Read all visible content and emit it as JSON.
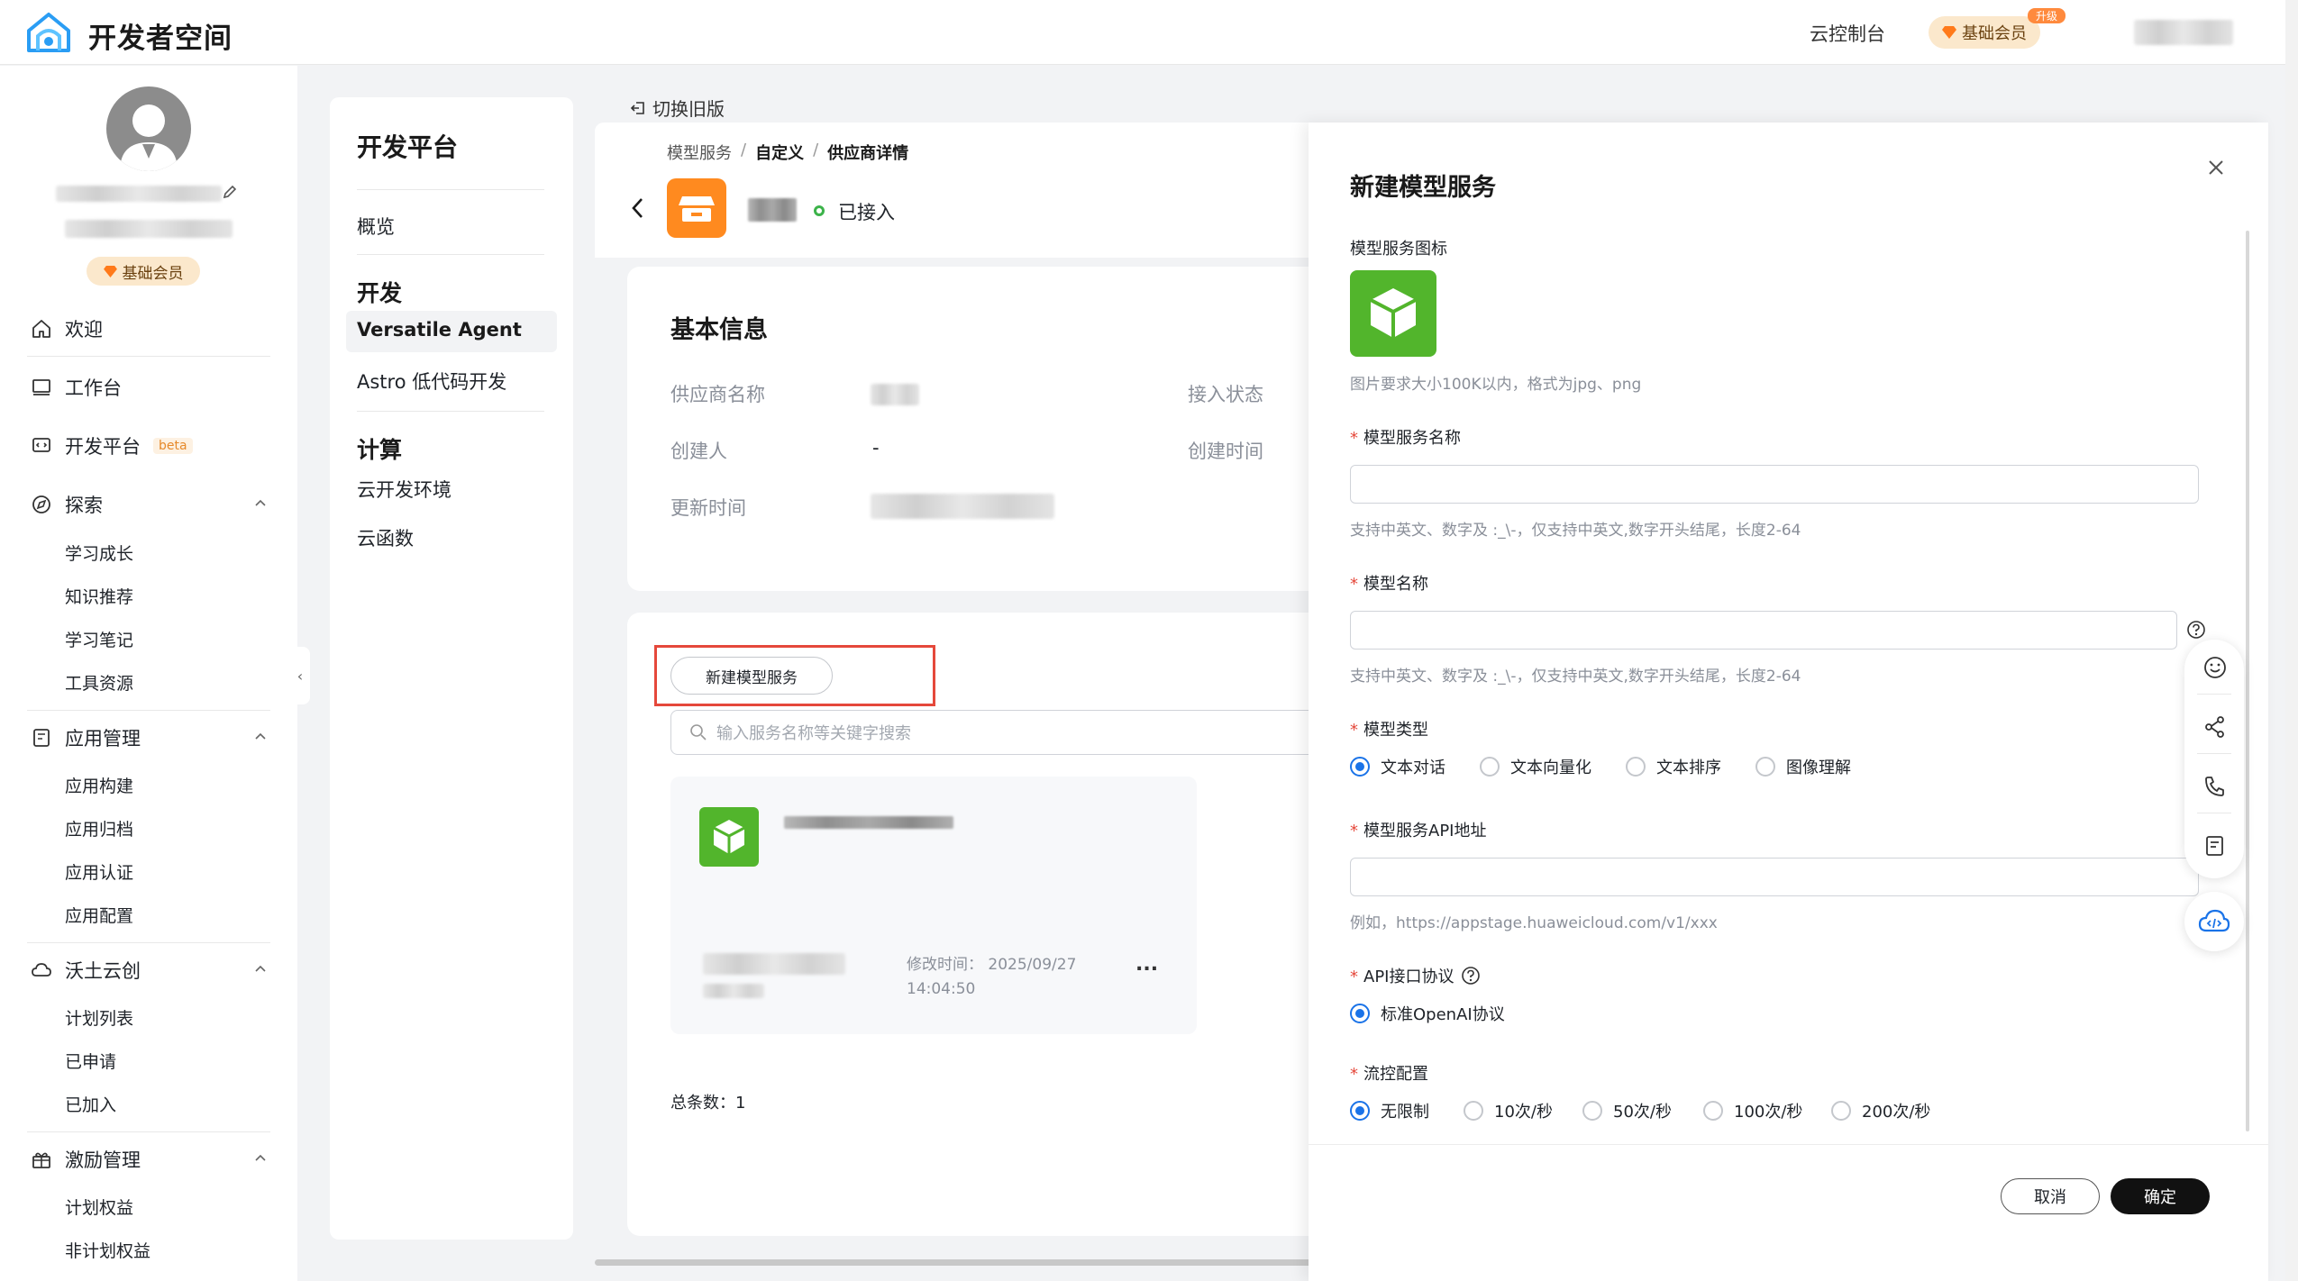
{
  "app": {
    "brand": "开发者空间",
    "console": "云控制台",
    "vip_badge": "基础会员",
    "upgrade_tag": "升级"
  },
  "profile": {
    "vip_badge": "基础会员"
  },
  "sidebar": {
    "welcome": "欢迎",
    "workbench": "工作台",
    "devplatform": "开发平台",
    "beta": "beta",
    "explore": {
      "label": "探索",
      "items": [
        "学习成长",
        "知识推荐",
        "学习笔记",
        "工具资源"
      ]
    },
    "appmgmt": {
      "label": "应用管理",
      "items": [
        "应用构建",
        "应用归档",
        "应用认证",
        "应用配置"
      ]
    },
    "wotu": {
      "label": "沃土云创",
      "items": [
        "计划列表",
        "已申请",
        "已加入"
      ]
    },
    "incentive": {
      "label": "激励管理",
      "items": [
        "计划权益",
        "非计划权益"
      ]
    }
  },
  "devpanel": {
    "title": "开发平台",
    "overview": "概览",
    "dev_header": "开发",
    "versatile": "Versatile Agent",
    "astro": "Astro 低代码开发",
    "compute_header": "计算",
    "cloud_env": "云开发环境",
    "cloud_func": "云函数"
  },
  "main": {
    "switch_old": "切换旧版",
    "breadcrumb": [
      "模型服务",
      "自定义",
      "供应商详情"
    ],
    "breadcrumb_sep": "/",
    "status": "已接入",
    "info": {
      "title": "基本信息",
      "provider_name": "供应商名称",
      "creator": "创建人",
      "creator_value": "-",
      "updated": "更新时间",
      "access_status": "接入状态",
      "created": "创建时间"
    },
    "new_service_button": "新建模型服务",
    "search_placeholder": "输入服务名称等关键字搜索",
    "card": {
      "modified_label": "修改时间：",
      "modified_date": "2025/09/27",
      "modified_time": "14:04:50",
      "more": "..."
    },
    "total": "总条数：1"
  },
  "drawer": {
    "title": "新建模型服务",
    "icon_label": "模型服务图标",
    "icon_hint": "图片要求大小100K以内，格式为jpg、png",
    "service_name_label": "模型服务名称",
    "service_name_value": "",
    "service_name_hint": "支持中英文、数字及 :_\\-，仅支持中英文,数字开头结尾，长度2-64",
    "model_name_label": "模型名称",
    "model_name_value": "",
    "model_name_hint": "支持中英文、数字及 :_\\-，仅支持中英文,数字开头结尾，长度2-64",
    "model_type_label": "模型类型",
    "model_types": [
      "文本对话",
      "文本向量化",
      "文本排序",
      "图像理解"
    ],
    "model_type_selected": "文本对话",
    "api_label": "模型服务API地址",
    "api_value": "",
    "api_hint": "例如，https://appstage.huaweicloud.com/v1/xxx",
    "protocol_label": "API接口协议",
    "protocols": [
      "标准OpenAI协议"
    ],
    "flow_label": "流控配置",
    "flow_options": [
      "无限制",
      "10次/秒",
      "50次/秒",
      "100次/秒",
      "200次/秒"
    ],
    "flow_selected": "无限制",
    "cancel": "取消",
    "confirm": "确定"
  },
  "colors": {
    "accent": "#1a73e8",
    "primary_dark": "#111111",
    "highlight_red": "#e5483b",
    "green_icon": "#52b52c",
    "orange_icon": "#ff8a1f",
    "vip_bg": "#fbe8cc"
  }
}
